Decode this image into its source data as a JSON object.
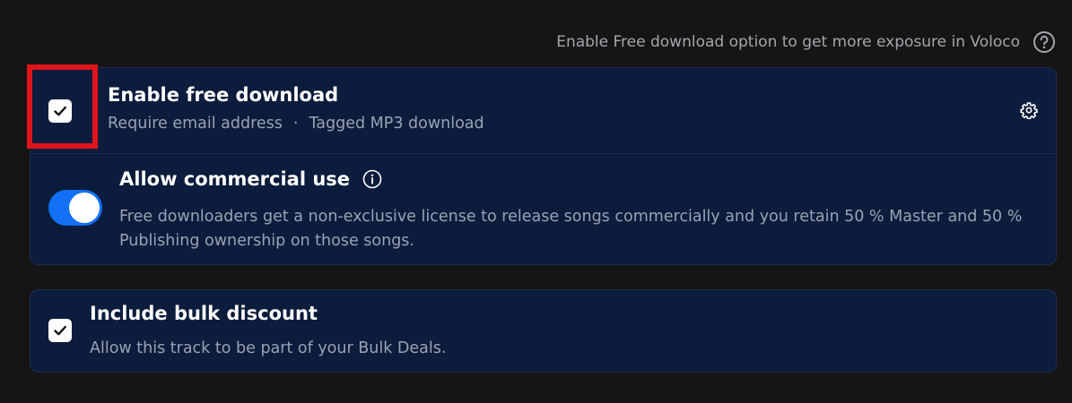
{
  "header": {
    "hint_text": "Enable Free download option to get more exposure in Voloco",
    "help_icon": "question-circle-icon"
  },
  "free_download": {
    "checked": true,
    "title": "Enable free download",
    "option_email": "Require email address",
    "separator": "·",
    "option_format": "Tagged MP3 download",
    "settings_icon": "gear-icon"
  },
  "commercial": {
    "enabled": true,
    "title": "Allow commercial use",
    "info_icon": "info-circle-icon",
    "description": "Free downloaders get a non-exclusive license to release songs commercially and you retain 50 % Master and 50 % Publishing ownership on those songs."
  },
  "bulk": {
    "checked": true,
    "title": "Include bulk discount",
    "description": "Allow this track to be part of your Bulk Deals."
  },
  "colors": {
    "background": "#151515",
    "card": "#0b1c3c",
    "accent": "#1170f4",
    "highlight": "#e0141b",
    "muted_text": "#9ba3b2"
  }
}
